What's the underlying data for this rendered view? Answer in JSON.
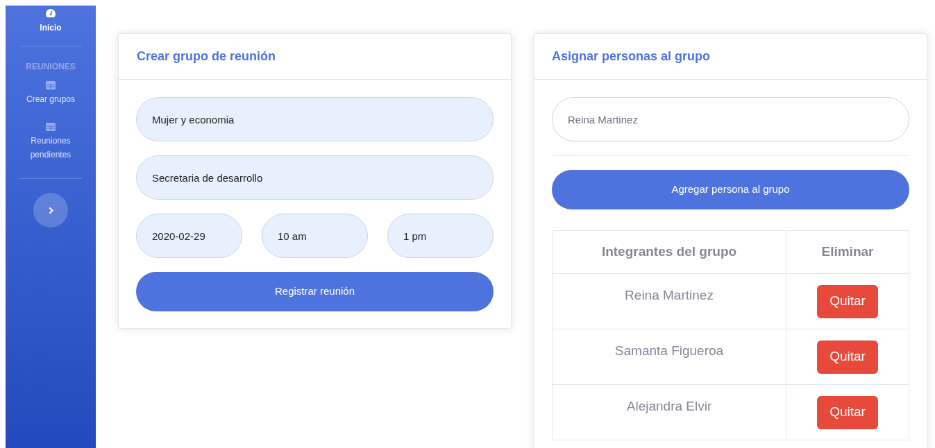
{
  "sidebar": {
    "items": [
      {
        "kind": "link",
        "label": "Inicio",
        "selected": true
      },
      {
        "kind": "heading",
        "label": "REUNIONES"
      },
      {
        "kind": "link",
        "label": "Crear grupos",
        "selected": false
      },
      {
        "kind": "link",
        "label": "Reuniones pendientes",
        "selected": false
      }
    ]
  },
  "create_card": {
    "title": "Crear grupo de reunión",
    "name_field": {
      "value": "Mujer y economia"
    },
    "department_field": {
      "value": "Secretaria de desarrollo"
    },
    "date_field": {
      "value": "2020-02-29"
    },
    "start_field": {
      "value": "10 am"
    },
    "end_field": {
      "value": "1 pm"
    },
    "submit": "Registrar reunión"
  },
  "assign_card": {
    "title": "Asignar personas al grupo",
    "person_field": {
      "value": "Reina Martinez"
    },
    "add_button": "Agregar persona al grupo",
    "table": {
      "columns": [
        "Integrantes del grupo",
        "Eliminar"
      ],
      "rows": [
        {
          "name": "Reina Martinez",
          "action": "Quitar"
        },
        {
          "name": "Samanta Figueroa",
          "action": "Quitar"
        },
        {
          "name": "Alejandra Elvir",
          "action": "Quitar"
        }
      ]
    }
  }
}
